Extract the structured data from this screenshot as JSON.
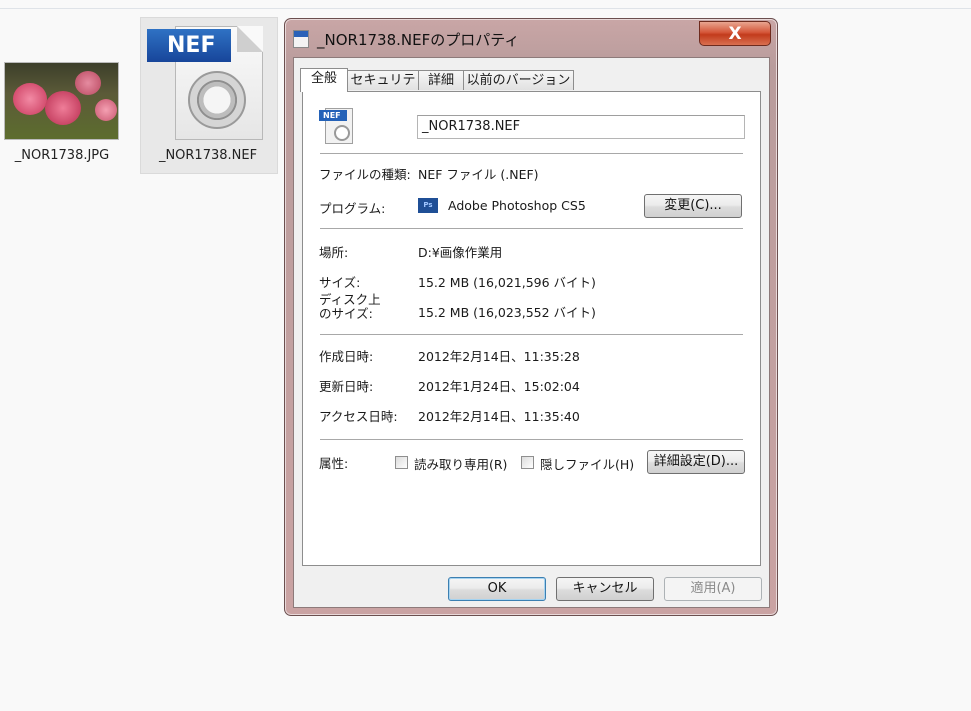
{
  "desktop": {
    "files": [
      {
        "name": "_NOR1738.JPG"
      },
      {
        "name": "_NOR1738.NEF",
        "badge": "NEF"
      }
    ]
  },
  "dialog": {
    "title": "_NOR1738.NEFのプロパティ",
    "close_label": "X",
    "tabs": [
      "全般",
      "セキュリティ",
      "詳細",
      "以前のバージョン"
    ],
    "general": {
      "icon_badge": "NEF",
      "file_name": "_NOR1738.NEF",
      "type_label": "ファイルの種類:",
      "type_value": "NEF ファイル (.NEF)",
      "program_label": "プログラム:",
      "program_icon_text": "Ps",
      "program_value": "Adobe Photoshop CS5",
      "change_button": "変更(C)...",
      "location_label": "場所:",
      "location_value": "D:¥画像作業用",
      "size_label": "サイズ:",
      "size_value": "15.2 MB (16,021,596 バイト)",
      "disk_size_label_1": "ディスク上",
      "disk_size_label_2": "のサイズ:",
      "disk_size_value": "15.2 MB (16,023,552 バイト)",
      "created_label": "作成日時:",
      "created_value": "2012年2月14日、11:35:28",
      "modified_label": "更新日時:",
      "modified_value": "2012年1月24日、15:02:04",
      "accessed_label": "アクセス日時:",
      "accessed_value": "2012年2月14日、11:35:40",
      "attributes_label": "属性:",
      "readonly_label": "読み取り専用(R)",
      "readonly_checked": false,
      "hidden_label": "隠しファイル(H)",
      "hidden_checked": false,
      "advanced_button": "詳細設定(D)..."
    },
    "buttons": {
      "ok": "OK",
      "cancel": "キャンセル",
      "apply": "適用(A)"
    }
  }
}
